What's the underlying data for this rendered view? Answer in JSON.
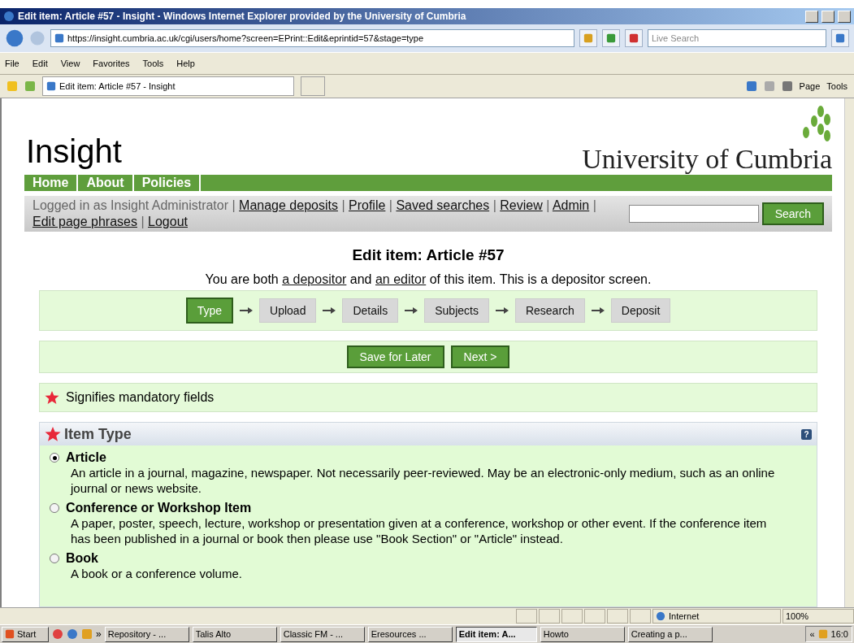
{
  "window": {
    "title": "Edit item: Article #57 - Insight - Windows Internet Explorer provided by the University of Cumbria"
  },
  "address_bar": {
    "url": "https://insight.cumbria.ac.uk/cgi/users/home?screen=EPrint::Edit&eprintid=57&stage=type",
    "search_placeholder": "Live Search"
  },
  "menu": [
    "File",
    "Edit",
    "View",
    "Favorites",
    "Tools",
    "Help"
  ],
  "favorites_bar": {
    "tab": "Edit item: Article #57 - Insight",
    "tools": [
      "Page",
      "Tools"
    ]
  },
  "site": {
    "title": "Insight",
    "logo_text": "University of Cumbria",
    "nav": [
      "Home",
      "About",
      "Policies"
    ],
    "login_text": "Logged in as Insight Administrator",
    "separator": "|",
    "links": [
      "Manage deposits",
      "Profile",
      "Saved searches",
      "Review",
      "Admin",
      "Edit page phrases",
      "Logout"
    ],
    "search_button": "Search"
  },
  "page": {
    "heading": "Edit item: Article #57",
    "intro": [
      {
        "kind": "text",
        "text": "You are both "
      },
      {
        "kind": "link",
        "text": "a depositor"
      },
      {
        "kind": "text",
        "text": " and "
      },
      {
        "kind": "link",
        "text": "an editor"
      },
      {
        "kind": "text",
        "text": " of this item. This is a depositor screen."
      }
    ],
    "workflow": [
      {
        "label": "Type",
        "selected": true
      },
      {
        "label": "Upload",
        "selected": false
      },
      {
        "label": "Details",
        "selected": false
      },
      {
        "label": "Subjects",
        "selected": false
      },
      {
        "label": "Research",
        "selected": false
      },
      {
        "label": "Deposit",
        "selected": false
      }
    ],
    "actions": [
      "Save for Later",
      "Next >"
    ],
    "mandatory_note": "Signifies mandatory fields",
    "item_type": {
      "title": "Item Type",
      "help": "?",
      "options": [
        {
          "label": "Article",
          "description": "An article in a journal, magazine, newspaper. Not necessarily peer-reviewed. May be an electronic-only medium, such as an online journal or news website.",
          "selected": true
        },
        {
          "label": "Conference or Workshop Item",
          "description": "A paper, poster, speech, lecture, workshop or presentation given at a conference, workshop or other event. If the conference item has been published in a journal or book then please use \"Book Section\" or \"Article\" instead.",
          "selected": false
        },
        {
          "label": "Book",
          "description": "A book or a conference volume.",
          "selected": false
        }
      ]
    }
  },
  "status_bar": {
    "zone": "Internet",
    "zoom": "100%"
  },
  "taskbar": {
    "start": "Start",
    "chevron": "»",
    "tasks": [
      {
        "label": "Repository - ...",
        "active": false
      },
      {
        "label": "Talis Alto",
        "active": false
      },
      {
        "label": "Classic FM - ...",
        "active": false
      },
      {
        "label": "Eresources ...",
        "active": false
      },
      {
        "label": "Edit item: A...",
        "active": true
      },
      {
        "label": "Howto",
        "active": false
      },
      {
        "label": "Creating a p...",
        "active": false
      }
    ],
    "tray_chevron": "«",
    "clock": "16:0"
  }
}
